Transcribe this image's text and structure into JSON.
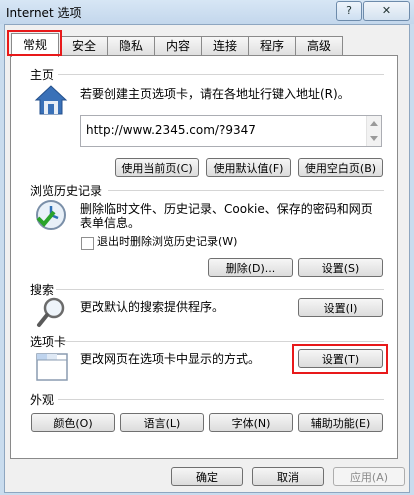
{
  "window": {
    "title": "Internet 选项",
    "help_label": "?",
    "close_label": "✕"
  },
  "tabs": [
    {
      "label": "常规",
      "active": true
    },
    {
      "label": "安全"
    },
    {
      "label": "隐私"
    },
    {
      "label": "内容"
    },
    {
      "label": "连接"
    },
    {
      "label": "程序"
    },
    {
      "label": "高级"
    }
  ],
  "homepage": {
    "title": "主页",
    "description": "若要创建主页选项卡，请在各地址行键入地址(R)。",
    "url": "http://www.2345.com/?9347",
    "buttons": [
      "使用当前页(C)",
      "使用默认值(F)",
      "使用空白页(B)"
    ]
  },
  "history": {
    "title": "浏览历史记录",
    "description_line1": "删除临时文件、历史记录、Cookie、保存的密码和网页",
    "description_line2": "表单信息。",
    "checkbox_label": "退出时删除浏览历史记录(W)",
    "checkbox_checked": false,
    "delete_button": "删除(D)...",
    "settings_button": "设置(S)"
  },
  "search": {
    "title": "搜索",
    "description": "更改默认的搜索提供程序。",
    "settings_button": "设置(I)"
  },
  "tabs_section": {
    "title": "选项卡",
    "description": "更改网页在选项卡中显示的方式。",
    "settings_button": "设置(T)"
  },
  "appearance": {
    "title": "外观",
    "buttons": [
      "颜色(O)",
      "语言(L)",
      "字体(N)",
      "辅助功能(E)"
    ]
  },
  "footer": {
    "ok": "确定",
    "cancel": "取消",
    "apply": "应用(A)"
  },
  "colors": {
    "highlight_red": "#e8191a",
    "accent_blue": "#2a66b7"
  }
}
